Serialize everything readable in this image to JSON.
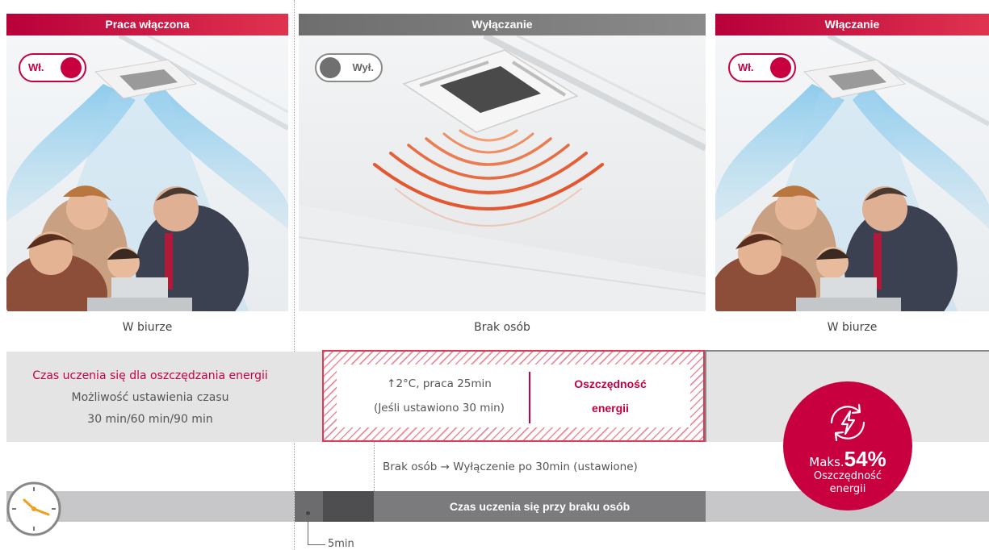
{
  "panels": {
    "left": {
      "header": "Praca włączona",
      "toggle": "Wł.",
      "caption": "W biurze"
    },
    "middle": {
      "header": "Wyłączanie",
      "toggle": "Wył.",
      "caption": "Brak osób"
    },
    "right": {
      "header": "Włączanie",
      "toggle": "Wł.",
      "caption": "W biurze"
    }
  },
  "learning": {
    "title": "Czas uczenia się dla oszczędzania energii",
    "line2": "Możliwość ustawienia czasu",
    "line3": "30 min/60 min/90 min"
  },
  "savings": {
    "line1": "↑2°C, praca 25min",
    "line2": "(Jeśli ustawiono 30 min)",
    "label1": "Oszczędność",
    "label2": "energii"
  },
  "no_people_note": "Brak osób → Wyłączenie po 30min (ustawione)",
  "timeline": {
    "label": "Czas uczenia się przy braku osób",
    "marker": "5min"
  },
  "badge": {
    "prefix": "Maks.",
    "value": "54%",
    "line1": "Oszczędność",
    "line2": "energii",
    "icon": "energy-cycle-icon"
  },
  "icons": [
    "clock-icon",
    "energy-cycle-icon"
  ],
  "colors": {
    "accent": "#c8003f",
    "gray": "#7a7a7a",
    "band": "#e4e4e4"
  }
}
